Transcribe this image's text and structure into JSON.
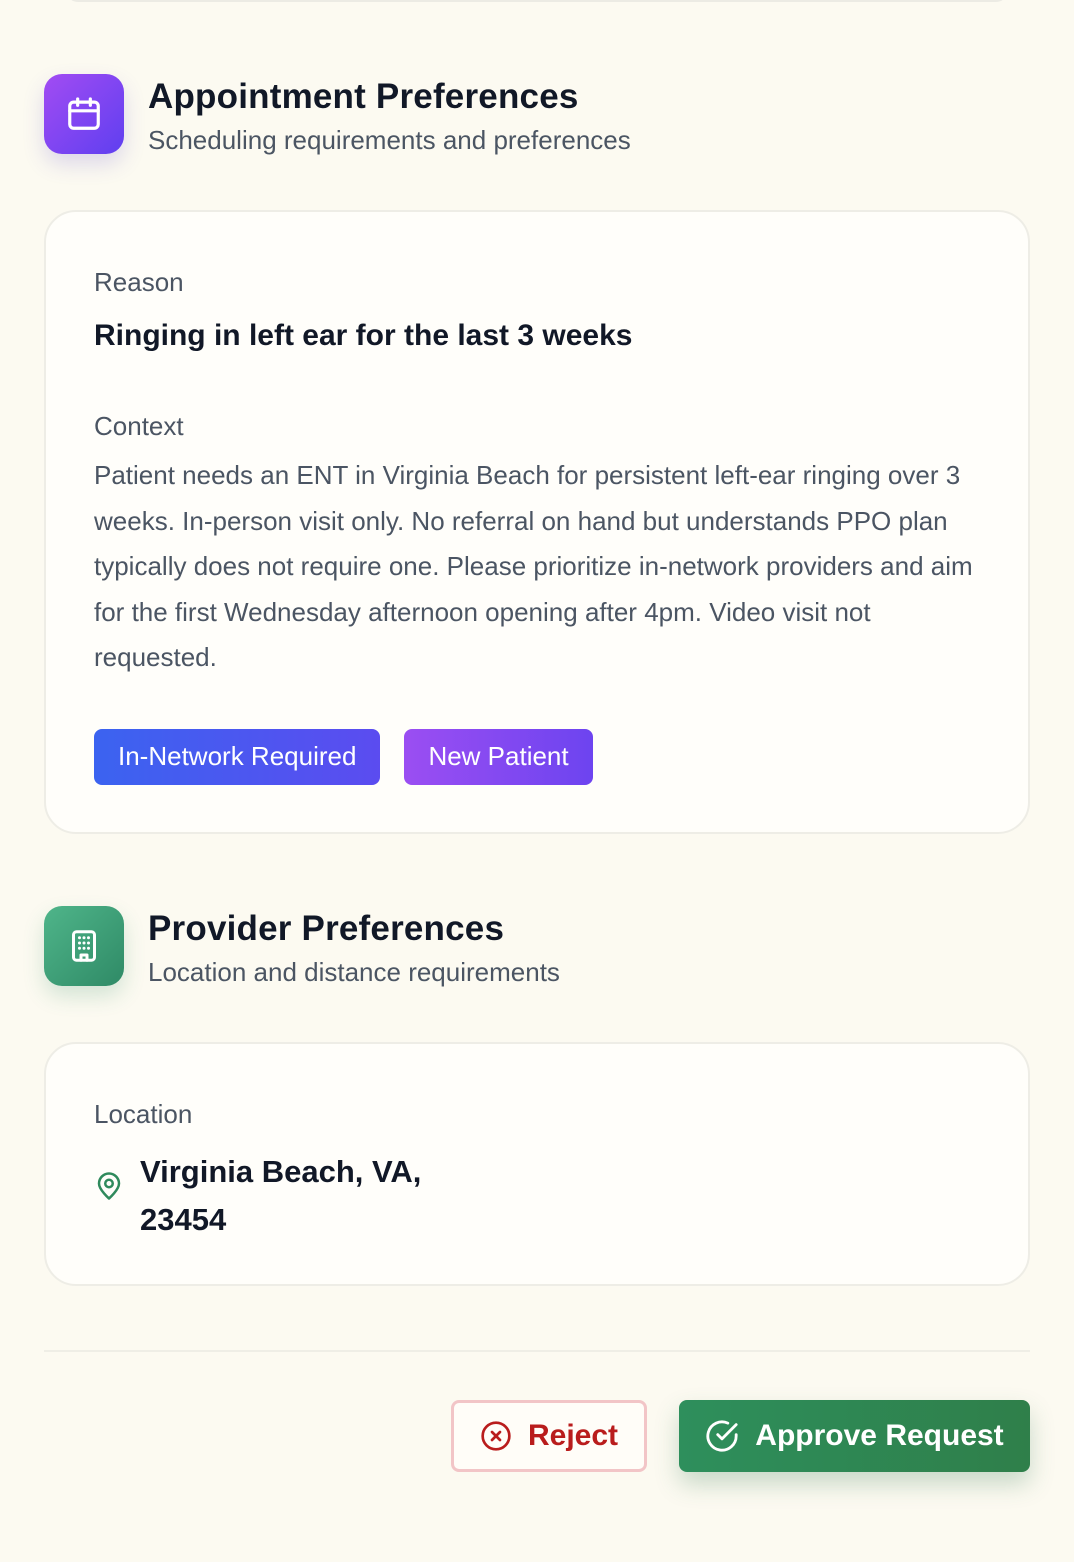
{
  "appointment": {
    "title": "Appointment Preferences",
    "subtitle": "Scheduling requirements and preferences",
    "reason_label": "Reason",
    "reason_value": "Ringing in left ear for the last 3 weeks",
    "context_label": "Context",
    "context_value": "Patient needs an ENT in Virginia Beach for persistent left-ear ringing over 3 weeks. In-person visit only. No referral on hand but understands PPO plan typically does not require one. Please prioritize in-network providers and aim for the first Wednesday afternoon opening after 4pm. Video visit not requested.",
    "tags": [
      {
        "label": "In-Network Required",
        "color": "#3b63f0"
      },
      {
        "label": "New Patient",
        "color": "#8b4cf2"
      }
    ]
  },
  "provider": {
    "title": "Provider Preferences",
    "subtitle": "Location and distance requirements",
    "location_label": "Location",
    "location_value": "Virginia Beach, VA, 23454"
  },
  "actions": {
    "reject_label": "Reject",
    "approve_label": "Approve Request"
  },
  "icons": {
    "appointment": "calendar-icon",
    "provider": "building-icon",
    "location": "map-pin-icon",
    "reject": "x-circle-icon",
    "approve": "check-circle-icon"
  },
  "colors": {
    "purple_accent": "#7c3aed",
    "green_accent": "#2f8a5c",
    "reject_red": "#b91c1c"
  }
}
